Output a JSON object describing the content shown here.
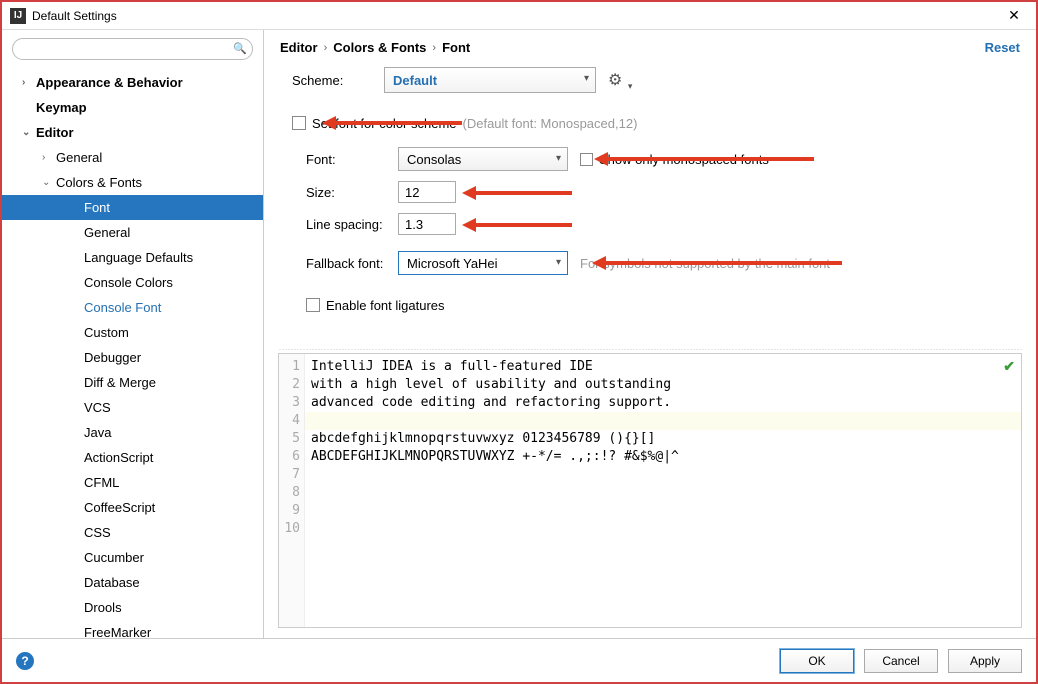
{
  "window": {
    "title": "Default Settings"
  },
  "sidebar": {
    "items": [
      {
        "label": "Appearance & Behavior",
        "level": 0,
        "arrow": "›",
        "bold": true
      },
      {
        "label": "Keymap",
        "level": 0,
        "arrow": "",
        "bold": true
      },
      {
        "label": "Editor",
        "level": 0,
        "arrow": "⌄",
        "bold": true
      },
      {
        "label": "General",
        "level": 1,
        "arrow": "›",
        "bold": false
      },
      {
        "label": "Colors & Fonts",
        "level": 1,
        "arrow": "⌄",
        "bold": false
      },
      {
        "label": "Font",
        "level": 2,
        "arrow": "",
        "bold": false,
        "selected": true
      },
      {
        "label": "General",
        "level": 2,
        "arrow": "",
        "bold": false
      },
      {
        "label": "Language Defaults",
        "level": 2,
        "arrow": "",
        "bold": false
      },
      {
        "label": "Console Colors",
        "level": 2,
        "arrow": "",
        "bold": false
      },
      {
        "label": "Console Font",
        "level": 2,
        "arrow": "",
        "bold": false,
        "bluelink": true
      },
      {
        "label": "Custom",
        "level": 2,
        "arrow": "",
        "bold": false
      },
      {
        "label": "Debugger",
        "level": 2,
        "arrow": "",
        "bold": false
      },
      {
        "label": "Diff & Merge",
        "level": 2,
        "arrow": "",
        "bold": false
      },
      {
        "label": "VCS",
        "level": 2,
        "arrow": "",
        "bold": false
      },
      {
        "label": "Java",
        "level": 2,
        "arrow": "",
        "bold": false
      },
      {
        "label": "ActionScript",
        "level": 2,
        "arrow": "",
        "bold": false
      },
      {
        "label": "CFML",
        "level": 2,
        "arrow": "",
        "bold": false
      },
      {
        "label": "CoffeeScript",
        "level": 2,
        "arrow": "",
        "bold": false
      },
      {
        "label": "CSS",
        "level": 2,
        "arrow": "",
        "bold": false
      },
      {
        "label": "Cucumber",
        "level": 2,
        "arrow": "",
        "bold": false
      },
      {
        "label": "Database",
        "level": 2,
        "arrow": "",
        "bold": false
      },
      {
        "label": "Drools",
        "level": 2,
        "arrow": "",
        "bold": false
      },
      {
        "label": "FreeMarker",
        "level": 2,
        "arrow": "",
        "bold": false
      }
    ]
  },
  "breadcrumb": {
    "a": "Editor",
    "b": "Colors & Fonts",
    "c": "Font",
    "reset": "Reset"
  },
  "form": {
    "scheme_label": "Scheme:",
    "scheme_value": "Default",
    "set_font_prefix": "Set ",
    "set_font_strike": "font for color scheme",
    "set_font_hint": "(Default font: Monospaced,12)",
    "font_label": "Font:",
    "font_value": "Consolas",
    "mono_prefix": "Sho",
    "mono_strike": "w only monospaced fonts",
    "size_label": "Size:",
    "size_value": "12",
    "ls_label": "Line spacing:",
    "ls_value": "1.3",
    "fallback_label": "Fallback font:",
    "fallback_value": "Microsoft YaHei",
    "fallback_hint_prefix": "For ",
    "fallback_hint_strike": "symbols not supported by the main font",
    "ligatures_label": "Enable font ligatures"
  },
  "preview": {
    "lines": [
      "IntelliJ IDEA is a full-featured IDE",
      "with a high level of usability and outstanding",
      "advanced code editing and refactoring support.",
      "",
      "abcdefghijklmnopqrstuvwxyz 0123456789 (){}[]",
      "ABCDEFGHIJKLMNOPQRSTUVWXYZ +-*/= .,;:!? #&$%@|^",
      "",
      "",
      "",
      ""
    ],
    "highlight_line": 4
  },
  "footer": {
    "ok": "OK",
    "cancel": "Cancel",
    "apply": "Apply"
  }
}
